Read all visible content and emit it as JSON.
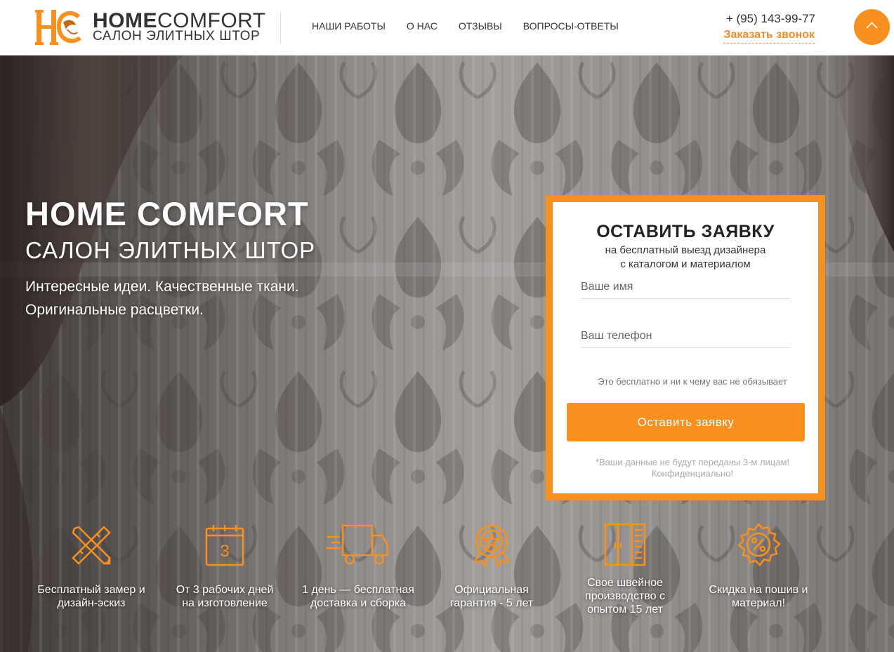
{
  "brand": {
    "name_bold": "HOME",
    "name_light": "COMFORT",
    "subtitle": "САЛОН ЭЛИТНЫХ ШТОР"
  },
  "nav": {
    "items": [
      "НАШИ РАБОТЫ",
      "О НАС",
      "ОТЗЫВЫ",
      "ВОПРОСЫ-ОТВЕТЫ"
    ]
  },
  "contact": {
    "phone": "+ (95) 143-99-77",
    "callback_label": "Заказать звонок"
  },
  "hero": {
    "title": "HOME COMFORT",
    "subtitle": "САЛОН ЭЛИТНЫХ ШТОР",
    "line1": "Интересные идеи. Качественные ткани.",
    "line2": "Оригинальные расцветки."
  },
  "form": {
    "title": "ОСТАВИТЬ ЗАЯВКУ",
    "sub1": "на бесплатный выезд дизайнера",
    "sub2": "с каталогом и материалом",
    "name_placeholder": "Ваше имя",
    "phone_placeholder": "Ваш телефон",
    "note": "Это бесплатно и ни к чему вас не обязывает",
    "button_label": "Оставить заявку",
    "privacy1": "*Ваши данные не будут переданы 3-м лицам!",
    "privacy2": "Конфиденциально!"
  },
  "features": [
    {
      "icon": "ruler-pencil-icon",
      "text_line1": "Бесплатный замер и",
      "text_line2": "дизайн-эскиз"
    },
    {
      "icon": "calendar-icon",
      "icon_number": "3",
      "text_line1": "От 3 рабочих дней",
      "text_line2": "на изготовление"
    },
    {
      "icon": "delivery-truck-icon",
      "text_line1": "1 день — бесплатная",
      "text_line2": "доставка и сборка"
    },
    {
      "icon": "award-star-icon",
      "text_line1": "Официальная",
      "text_line2": "гарантия - 5 лет"
    },
    {
      "icon": "wardrobe-icon",
      "text_line1": "Свое швейное",
      "text_line2": "производство с",
      "text_line3": "опытом 15 лет"
    },
    {
      "icon": "discount-badge-icon",
      "text_line1": "Скидка на пошив и",
      "text_line2": "материал!"
    }
  ],
  "colors": {
    "accent": "#f7901e",
    "text_dark": "#333333"
  }
}
